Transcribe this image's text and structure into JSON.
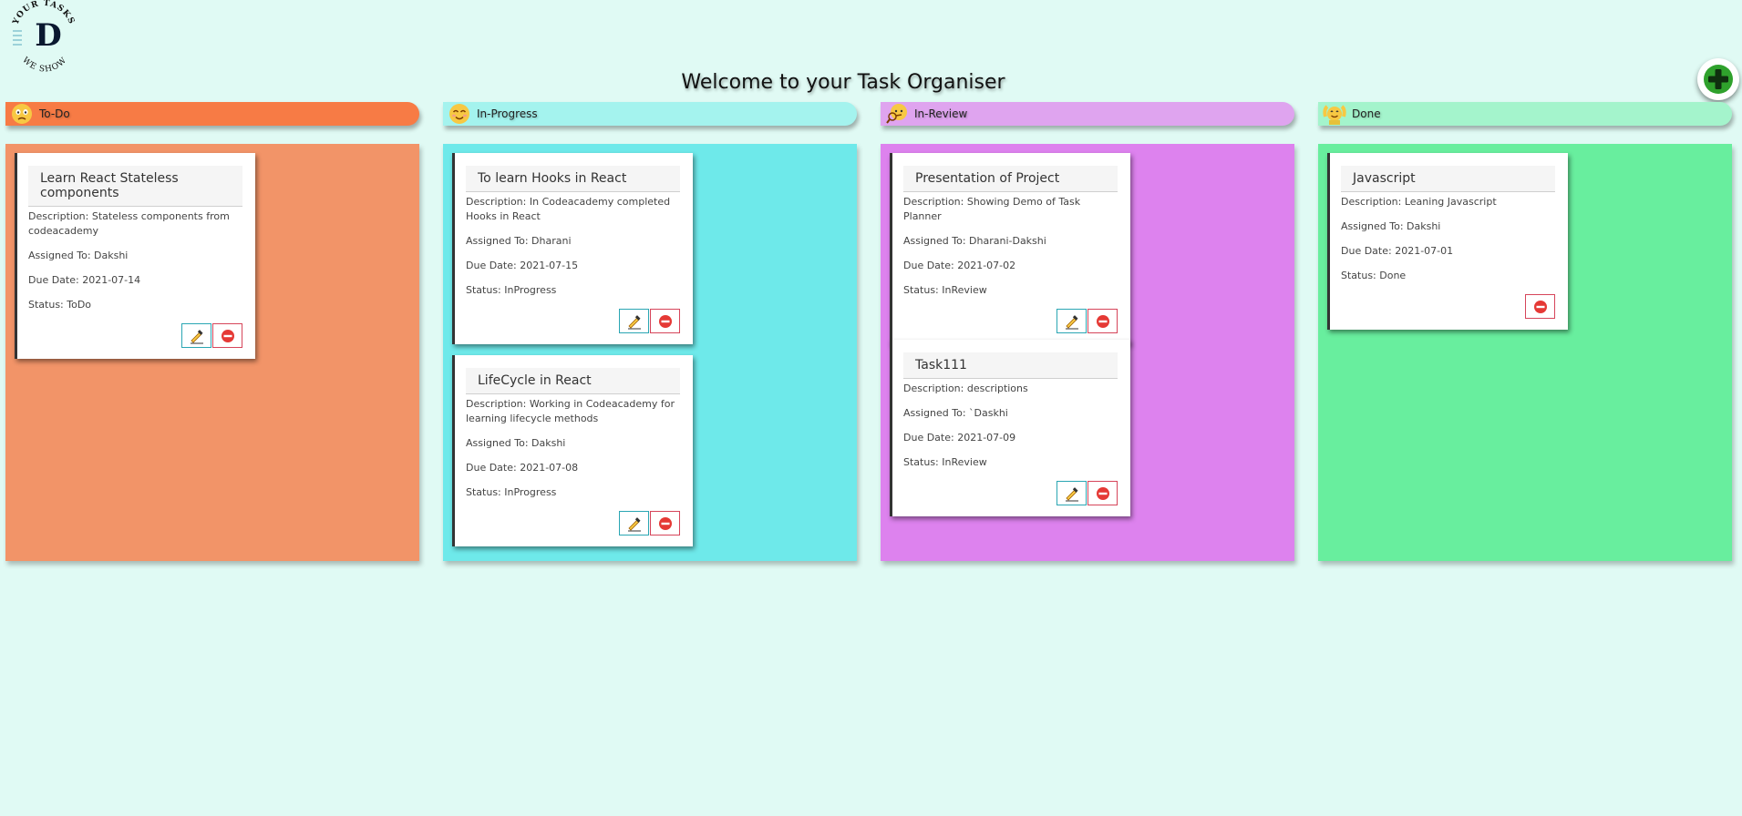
{
  "app": {
    "logo_top_text": "YOUR TASKS",
    "logo_letter": "D",
    "logo_bottom_text": "WE SHOW",
    "title": "Welcome to your Task Organiser"
  },
  "colors": {
    "background": "#e0faf4",
    "todo_header": "#f77b45",
    "todo_column": "#f29468",
    "inprogress_header": "#a4f3ee",
    "inprogress_column": "#6ee9ea",
    "inreview_header": "#dfa4ef",
    "inreview_column": "#dd82ee",
    "done_header": "#a4f4cc",
    "done_column": "#68ee9e",
    "add_button": "#2fa12c"
  },
  "columns": [
    {
      "label": "To-Do",
      "emoji": "worried-face-icon",
      "cards": [
        {
          "title": "Learn React Stateless components",
          "description": "Description: Stateless components from codeacademy",
          "assigned": "Assigned To: Dakshi",
          "due": "Due Date: 2021-07-14",
          "status": "Status: ToDo"
        }
      ]
    },
    {
      "label": "In-Progress",
      "emoji": "smiling-face-icon",
      "cards": [
        {
          "title": "To learn Hooks in React",
          "description": "Description: In Codeacademy completed Hooks in React",
          "assigned": "Assigned To: Dharani",
          "due": "Due Date: 2021-07-15",
          "status": "Status: InProgress"
        },
        {
          "title": "LifeCycle in React",
          "description": "Description: Working in Codeacademy for learning lifecycle methods",
          "assigned": "Assigned To: Dakshi",
          "due": "Due Date: 2021-07-08",
          "status": "Status: InProgress"
        }
      ]
    },
    {
      "label": "In-Review",
      "emoji": "detective-face-icon",
      "cards": [
        {
          "title": "Presentation of Project",
          "description": "Description: Showing Demo of Task Planner",
          "assigned": "Assigned To: Dharani-Dakshi",
          "due": "Due Date: 2021-07-02",
          "status": "Status: InReview"
        },
        {
          "title": "Task111",
          "description": "Description: descriptions",
          "assigned": "Assigned To: `Daskhi",
          "due": "Due Date: 2021-07-09",
          "status": "Status: InReview"
        }
      ]
    },
    {
      "label": "Done",
      "emoji": "celebrating-person-icon",
      "cards": [
        {
          "title": "Javascript",
          "description": "Description: Leaning Javascript",
          "assigned": "Assigned To: Dakshi",
          "due": "Due Date: 2021-07-01",
          "status": "Status: Done"
        }
      ]
    }
  ]
}
